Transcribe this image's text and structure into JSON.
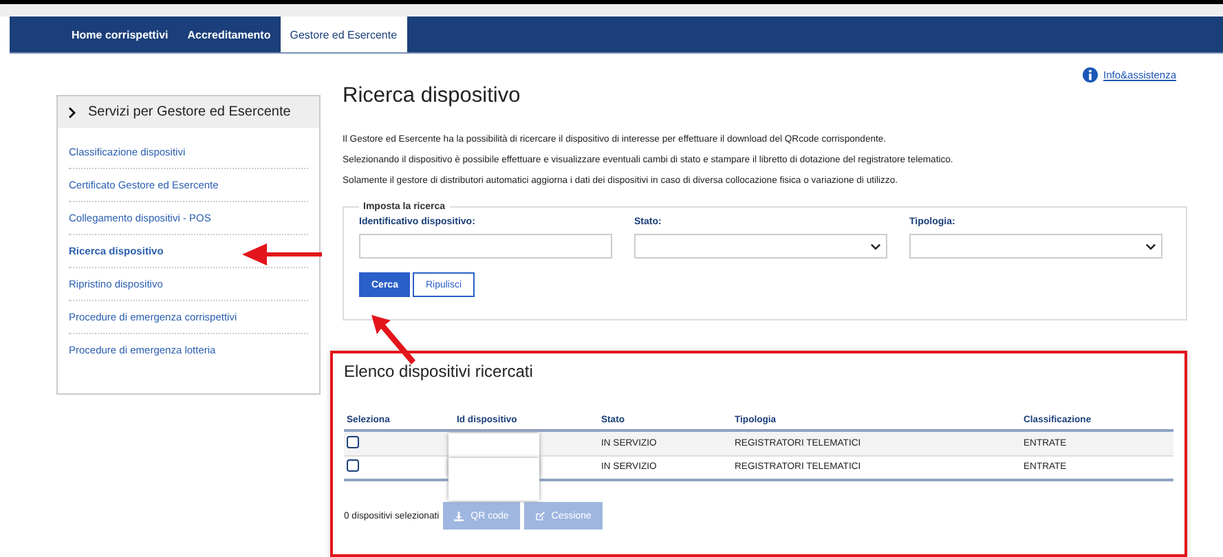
{
  "nav": {
    "tabs": [
      {
        "label": "Home corrispettivi",
        "selected": false
      },
      {
        "label": "Accreditamento",
        "selected": false
      },
      {
        "label": "Gestore ed Esercente",
        "selected": true
      }
    ]
  },
  "help_link": "Info&assistenza",
  "sidebar": {
    "title": "Servizi per Gestore ed Esercente",
    "items": [
      {
        "label": "Classificazione dispositivi",
        "selected": false
      },
      {
        "label": "Certificato Gestore ed Esercente",
        "selected": false
      },
      {
        "label": "Collegamento dispositivi - POS",
        "selected": false
      },
      {
        "label": "Ricerca dispositivo",
        "selected": true
      },
      {
        "label": "Ripristino dispositivo",
        "selected": false
      },
      {
        "label": "Procedure di emergenza corrispettivi",
        "selected": false
      },
      {
        "label": "Procedure di emergenza lotteria",
        "selected": false
      }
    ]
  },
  "page_title": "Ricerca dispositivo",
  "intro": [
    "Il Gestore ed Esercente ha la possibilità di ricercare il dispositivo di interesse per effettuare il download del QRcode corrispondente.",
    "Selezionando il dispositivo è possibile effettuare e visualizzare eventuali cambi di stato e stampare il libretto di dotazione del registratore telematico.",
    "Solamente il gestore di distributori automatici aggiorna i dati dei dispositivi in caso di diversa collocazione fisica o variazione di utilizzo."
  ],
  "search": {
    "legend": "Imposta la ricerca",
    "fields": [
      {
        "label": "Identificativo dispositivo:",
        "kind": "text"
      },
      {
        "label": "Stato:",
        "kind": "select"
      },
      {
        "label": "Tipologia:",
        "kind": "select"
      }
    ],
    "buttons": [
      {
        "label": "Cerca",
        "kind": "primary"
      },
      {
        "label": "Ripulisci",
        "kind": "secondary"
      }
    ]
  },
  "results": {
    "title": "Elenco dispositivi ricercati",
    "columns": [
      "Seleziona",
      "Id dispositivo",
      "Stato",
      "Tipologia",
      "Classificazione"
    ],
    "rows": [
      {
        "checked": false,
        "redacted": true,
        "stato": "IN SERVIZIO",
        "tipologia": "REGISTRATORI TELEMATICI",
        "classificazione": "ENTRATE"
      },
      {
        "checked": false,
        "redacted": true,
        "stato": "IN SERVIZIO",
        "tipologia": "REGISTRATORI TELEMATICI",
        "classificazione": "ENTRATE"
      }
    ],
    "selected_count": "0 dispositivi selezionati",
    "actions": [
      {
        "label": "QR code",
        "kind": "download",
        "disabled": true
      },
      {
        "label": "Cessione",
        "kind": "edit",
        "disabled": true
      }
    ]
  }
}
